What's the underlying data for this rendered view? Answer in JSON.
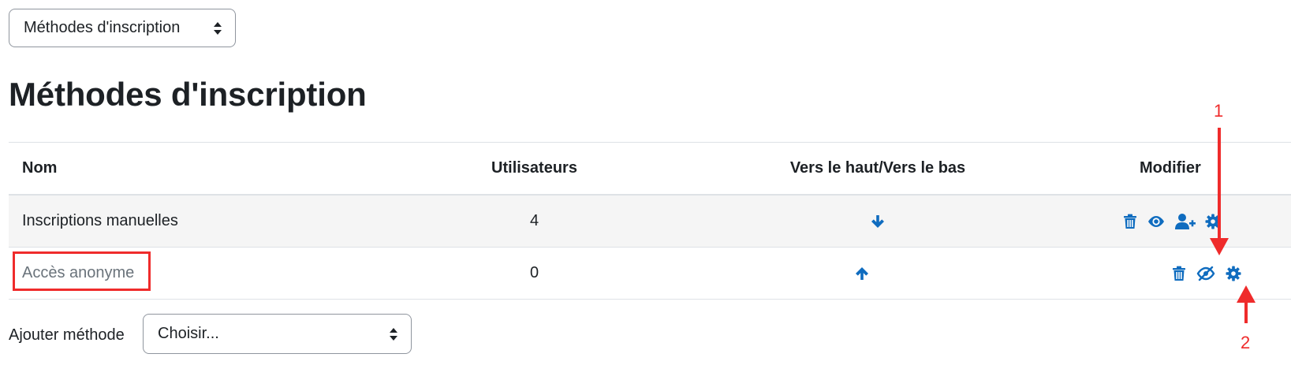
{
  "top_select": {
    "value": "Méthodes d'inscription"
  },
  "page": {
    "title": "Méthodes d'inscription"
  },
  "table": {
    "headers": {
      "name": "Nom",
      "users": "Utilisateurs",
      "updown": "Vers le haut/Vers le bas",
      "edit": "Modifier"
    },
    "rows": [
      {
        "name": "Inscriptions manuelles",
        "users": "4",
        "move": "down"
      },
      {
        "name": "Accès anonyme",
        "users": "0",
        "move": "up"
      }
    ]
  },
  "annotations": {
    "label_1": "1",
    "label_2": "2",
    "color": "#ef2b2b"
  },
  "add_method": {
    "label": "Ajouter méthode",
    "value": "Choisir..."
  },
  "colors": {
    "link": "#0f6cbf",
    "text": "#1d2125",
    "muted": "#6a737b",
    "annotation": "#ef2b2b"
  }
}
